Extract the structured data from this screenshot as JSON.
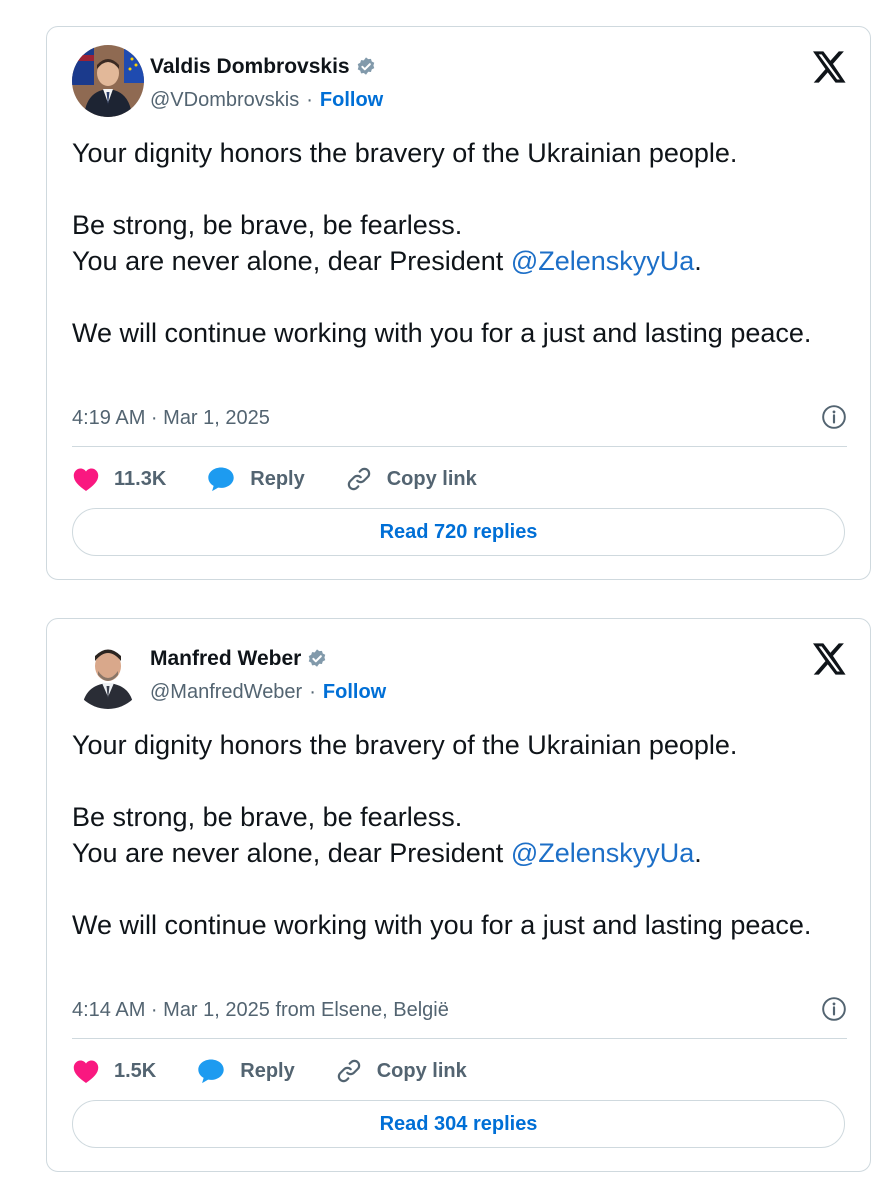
{
  "tweets": [
    {
      "display_name": "Valdis Dombrovskis",
      "handle": "@VDombrovskis",
      "follow_label": "Follow",
      "line1": "Your dignity honors the bravery of the Ukrainian people.",
      "line2": "Be strong, be brave, be fearless.",
      "line3_prefix": "You are never alone, dear President ",
      "mention": "@ZelenskyyUa",
      "line3_suffix": ".",
      "line4": "We will continue working with you for a just and lasting peace.",
      "timestamp": "4:19 AM · Mar 1, 2025",
      "like_count": "11.3K",
      "reply_label": "Reply",
      "copy_link_label": "Copy link",
      "read_replies_label": "Read 720 replies"
    },
    {
      "display_name": "Manfred Weber",
      "handle": "@ManfredWeber",
      "follow_label": "Follow",
      "line1": "Your dignity honors the bravery of the Ukrainian people.",
      "line2": "Be strong, be brave, be fearless.",
      "line3_prefix": "You are never alone, dear President ",
      "mention": "@ZelenskyyUa",
      "line3_suffix": ".",
      "line4": "We will continue working with you for a just and lasting peace.",
      "timestamp": "4:14 AM · Mar 1, 2025 from Elsene, België",
      "like_count": "1.5K",
      "reply_label": "Reply",
      "copy_link_label": "Copy link",
      "read_replies_label": "Read 304 replies"
    }
  ],
  "icons": {
    "verified": "verified-badge-icon",
    "platform": "x-logo-icon",
    "info": "info-icon",
    "like": "heart-icon",
    "reply": "speech-bubble-icon",
    "copy": "link-icon"
  },
  "colors": {
    "link_blue": "#006fd6",
    "mention_blue": "#1d6fc7",
    "heart_pink": "#f91880",
    "reply_blue": "#1d9bf0",
    "verified_grey": "#829aab",
    "muted_text": "#536471",
    "border": "#cfd9de"
  }
}
